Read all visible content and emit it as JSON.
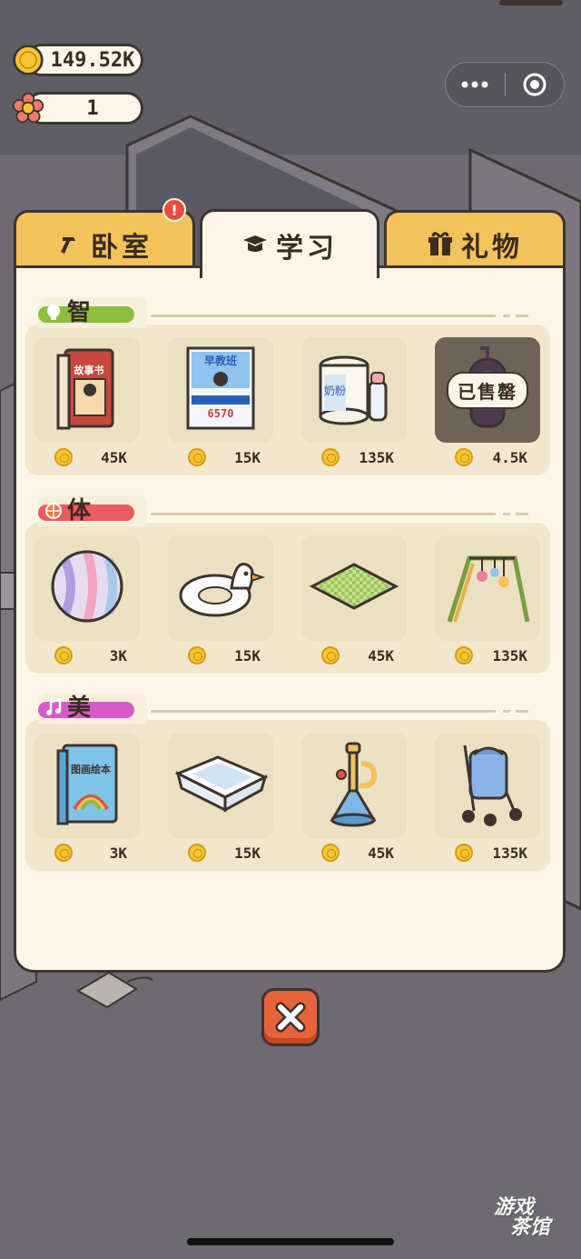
{
  "currency": {
    "coins": "149.52K",
    "flowers": "1"
  },
  "tabs": [
    {
      "label": "卧室",
      "icon": "hammer-icon",
      "alert": "!"
    },
    {
      "label": "学习",
      "icon": "graduation-cap-icon",
      "active": true
    },
    {
      "label": "礼物",
      "icon": "gift-icon"
    }
  ],
  "sections": [
    {
      "title": "智",
      "icon": "lightbulb-icon",
      "color": "#8bbf3c",
      "items": [
        {
          "name": "story-book",
          "text": "故事书",
          "price": "45K"
        },
        {
          "name": "early-education-poster",
          "text": "早教班",
          "text2": "6570",
          "price": "15K"
        },
        {
          "name": "milk-powder",
          "text": "奶粉",
          "price": "135K"
        },
        {
          "name": "teletubby-toy",
          "price": "4.5K",
          "sold_label": "已售罄"
        }
      ]
    },
    {
      "title": "体",
      "icon": "basketball-icon",
      "color": "#ec5a62",
      "items": [
        {
          "name": "beach-ball",
          "price": "3K"
        },
        {
          "name": "duck-swim-ring",
          "price": "15K"
        },
        {
          "name": "play-mat",
          "price": "45K"
        },
        {
          "name": "baby-play-gym",
          "price": "135K"
        }
      ]
    },
    {
      "title": "美",
      "icon": "music-note-icon",
      "color": "#d65bc9",
      "items": [
        {
          "name": "picture-book",
          "text": "图画绘本",
          "price": "3K"
        },
        {
          "name": "baby-bathtub",
          "price": "15K"
        },
        {
          "name": "trumpet-toy",
          "price": "45K"
        },
        {
          "name": "baby-stroller",
          "price": "135K"
        }
      ]
    }
  ],
  "watermark": {
    "line1": "游戏",
    "line2": "茶馆"
  },
  "colors": {
    "panel": "#fdf6e8",
    "tab": "#f2c35a",
    "close": "#e8623a"
  }
}
